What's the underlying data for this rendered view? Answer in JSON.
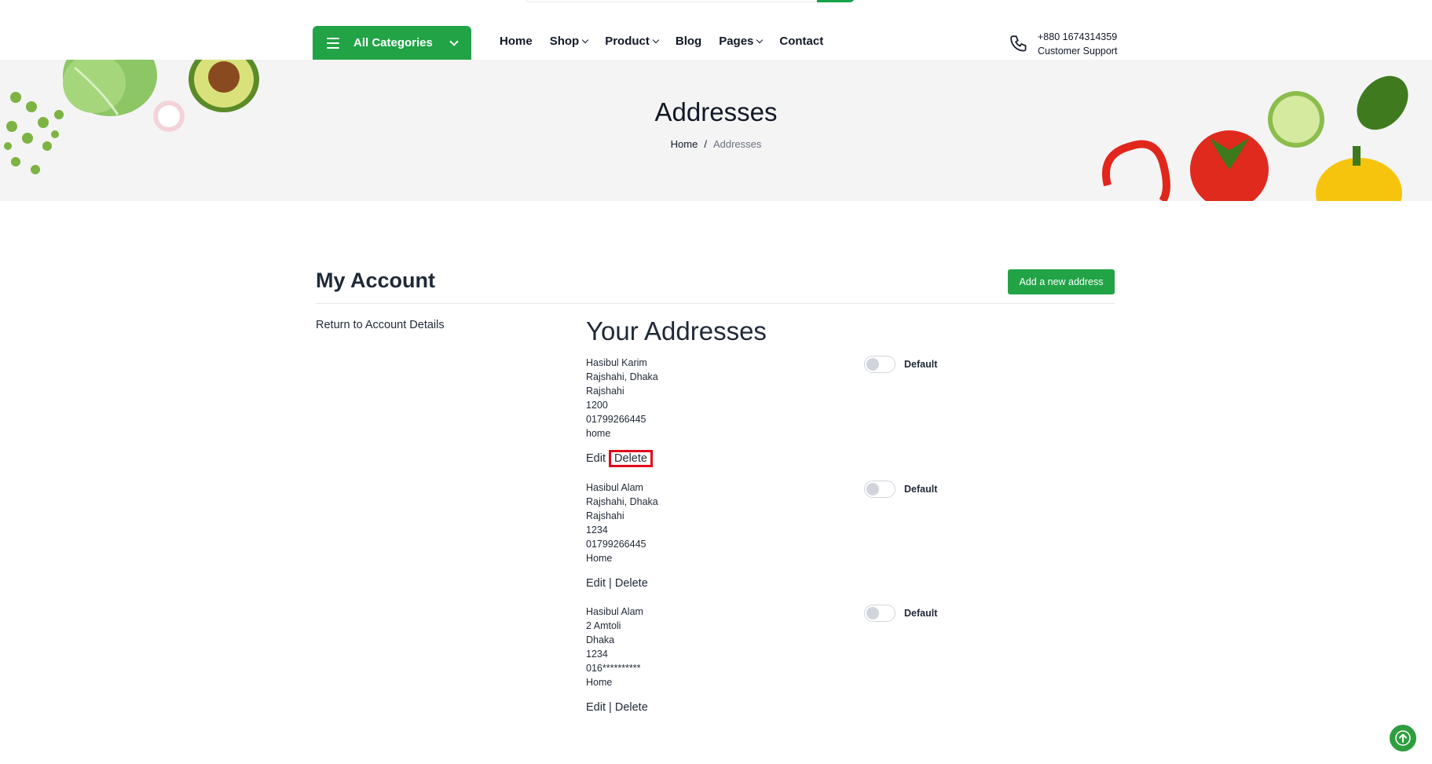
{
  "header": {
    "categories_label": "All Categories",
    "nav": [
      {
        "label": "Home",
        "dropdown": false
      },
      {
        "label": "Shop",
        "dropdown": true
      },
      {
        "label": "Product",
        "dropdown": true
      },
      {
        "label": "Blog",
        "dropdown": false
      },
      {
        "label": "Pages",
        "dropdown": true
      },
      {
        "label": "Contact",
        "dropdown": false
      }
    ],
    "support_phone": "+880 1674314359",
    "support_label": "Customer Support"
  },
  "banner": {
    "title": "Addresses",
    "breadcrumb_home": "Home",
    "breadcrumb_separator": "/",
    "breadcrumb_current": "Addresses"
  },
  "account": {
    "title": "My Account",
    "add_button": "Add a new address",
    "return_link": "Return to Account Details",
    "addresses_heading": "Your Addresses"
  },
  "addresses": [
    {
      "lines": [
        "Hasibul Karim",
        "Rajshahi, Dhaka",
        "Rajshahi",
        "1200",
        "01799266445",
        "home"
      ],
      "default_label": "Default",
      "default_on": false,
      "edit": "Edit",
      "separator": "|",
      "delete": "Delete"
    },
    {
      "lines": [
        "Hasibul Alam",
        "Rajshahi, Dhaka",
        "Rajshahi",
        "1234",
        "01799266445",
        "Home"
      ],
      "default_label": "Default",
      "default_on": false,
      "edit": "Edit",
      "separator": "|",
      "delete": "Delete"
    },
    {
      "lines": [
        "Hasibul Alam",
        "2 Amtoli",
        "Dhaka",
        "1234",
        "016**********",
        "Home"
      ],
      "default_label": "Default",
      "default_on": false,
      "edit": "Edit",
      "separator": "|",
      "delete": "Delete"
    }
  ],
  "colors": {
    "brand_green": "#21a346",
    "highlight_red": "#e00b1c",
    "banner_bg": "#f4f4f4"
  }
}
